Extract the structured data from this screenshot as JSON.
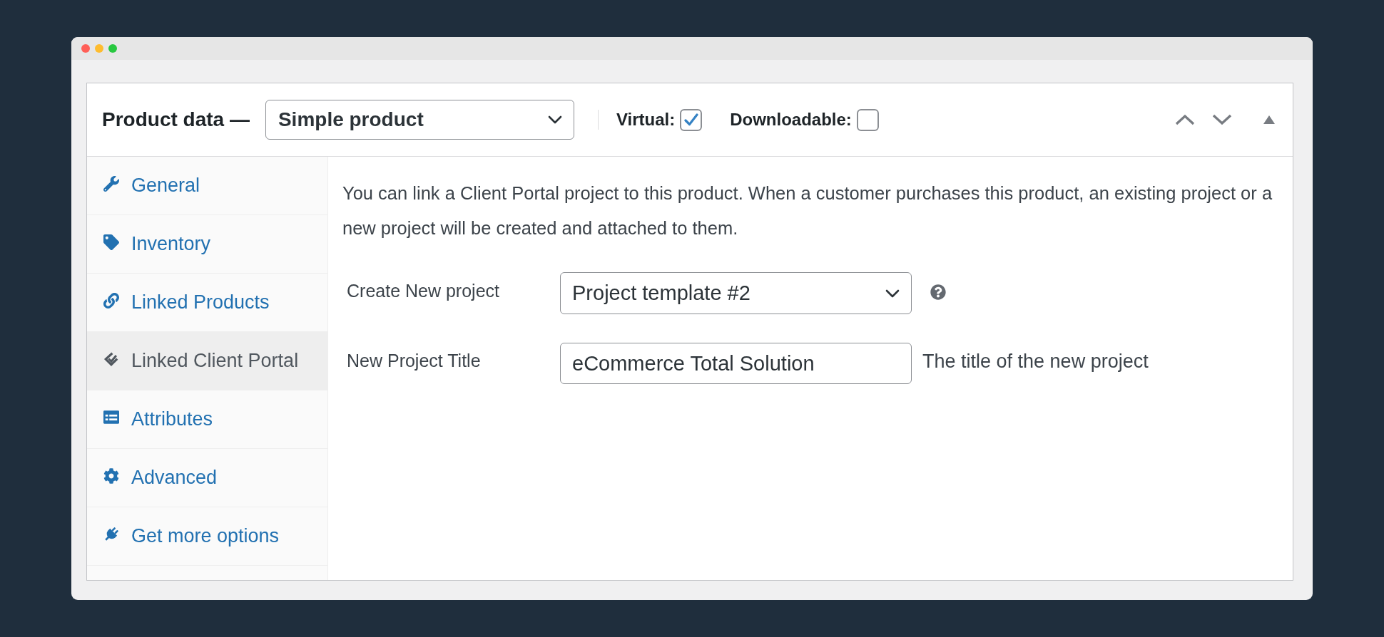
{
  "product_data": {
    "title": "Product data —",
    "product_type": "Simple product",
    "options": [
      {
        "label": "Virtual:",
        "checked": true
      },
      {
        "label": "Downloadable:",
        "checked": false
      }
    ]
  },
  "tabs": [
    {
      "label": "General",
      "kind": "general",
      "selected": false
    },
    {
      "label": "Inventory",
      "kind": "inventory",
      "selected": false
    },
    {
      "label": "Linked Products",
      "kind": "linked",
      "selected": false
    },
    {
      "label": "Linked Client Portal",
      "kind": "portal",
      "selected": true
    },
    {
      "label": "Attributes",
      "kind": "attributes",
      "selected": false
    },
    {
      "label": "Advanced",
      "kind": "advanced",
      "selected": false
    },
    {
      "label": "Get more options",
      "kind": "extensions",
      "selected": false
    }
  ],
  "panel": {
    "intro": "You can link a Client Portal project to this product. When a customer purchases this product, an existing project or a new project will be created and attached to them.",
    "fields": [
      {
        "kind": "select",
        "label": "Create New project",
        "value": "Project template #2",
        "help": true
      },
      {
        "kind": "text",
        "label": "New Project Title",
        "value": "eCommerce Total Solution",
        "description": "The title of the new project"
      }
    ]
  }
}
